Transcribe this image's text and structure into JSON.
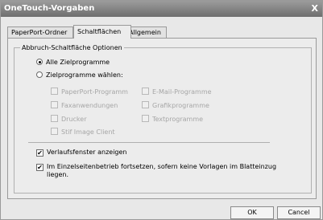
{
  "window": {
    "title": "OneTouch-Vorgaben",
    "close_glyph": "X"
  },
  "tabs": [
    {
      "label": "PaperPort-Ordner",
      "active": false
    },
    {
      "label": "Schaltflächen",
      "active": true
    },
    {
      "label": "Allgemein",
      "active": false
    }
  ],
  "group": {
    "label": "Abbruch-Schaltfläche Optionen"
  },
  "radios": [
    {
      "label": "Alle Zielprogramme",
      "selected": true
    },
    {
      "label": "Zielprogramme wählen:",
      "selected": false
    }
  ],
  "targets": {
    "left": [
      {
        "label": "PaperPort-Programm",
        "checked": false,
        "enabled": false
      },
      {
        "label": "Faxanwendungen",
        "checked": false,
        "enabled": false
      },
      {
        "label": "Drucker",
        "checked": false,
        "enabled": false
      },
      {
        "label": "Stif Image Client",
        "checked": false,
        "enabled": false
      }
    ],
    "right": [
      {
        "label": "E-Mail-Programme",
        "checked": false,
        "enabled": false
      },
      {
        "label": "Grafikprogramme",
        "checked": false,
        "enabled": false
      },
      {
        "label": "Textprogramme",
        "checked": false,
        "enabled": false
      }
    ]
  },
  "options": [
    {
      "label": "Verlaufsfenster anzeigen",
      "checked": true
    },
    {
      "label_line1": "Im Einzelseitenbetrieb fortsetzen, sofern keine Vorlagen im Blatteinzug",
      "label_line2": "liegen.",
      "checked": true
    }
  ],
  "buttons": {
    "ok": "OK",
    "cancel": "Cancel"
  },
  "check_glyph": "✔"
}
